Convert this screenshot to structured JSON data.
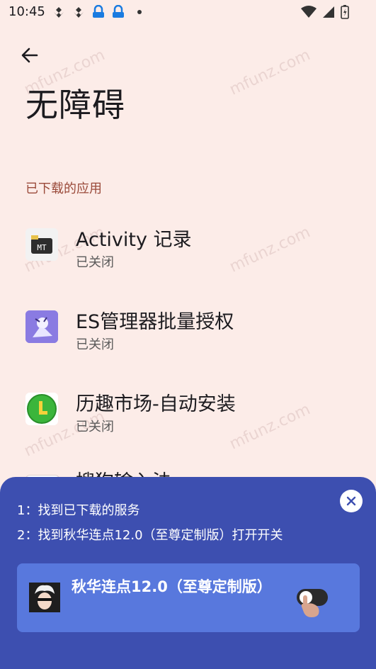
{
  "status_bar": {
    "time": "10:45"
  },
  "header": {
    "title": "无障碍"
  },
  "section": {
    "label": "已下载的应用"
  },
  "apps": [
    {
      "name": "Activity 记录",
      "status": "已关闭",
      "icon": "mt-activity-icon"
    },
    {
      "name": "ES管理器批量授权",
      "status": "已关闭",
      "icon": "anime-character-icon"
    },
    {
      "name": "历趣市场-自动安装",
      "status": "已关闭",
      "icon": "green-l-icon"
    },
    {
      "name": "搜狗输入法",
      "status": "",
      "icon": "sogou-icon"
    }
  ],
  "guide": {
    "step1": "1：找到已下载的服务",
    "step2": "2：找到秋华连点12.0（至尊定制版）打开开关",
    "service_name": "秋华连点12.0（至尊定制版）",
    "toggle_on": false
  },
  "watermark": {
    "text": "mfunz.com"
  },
  "colors": {
    "background": "#fcece8",
    "section_header": "#9a4a3a",
    "panel": "#3d4fb0",
    "card": "#5878dd"
  }
}
